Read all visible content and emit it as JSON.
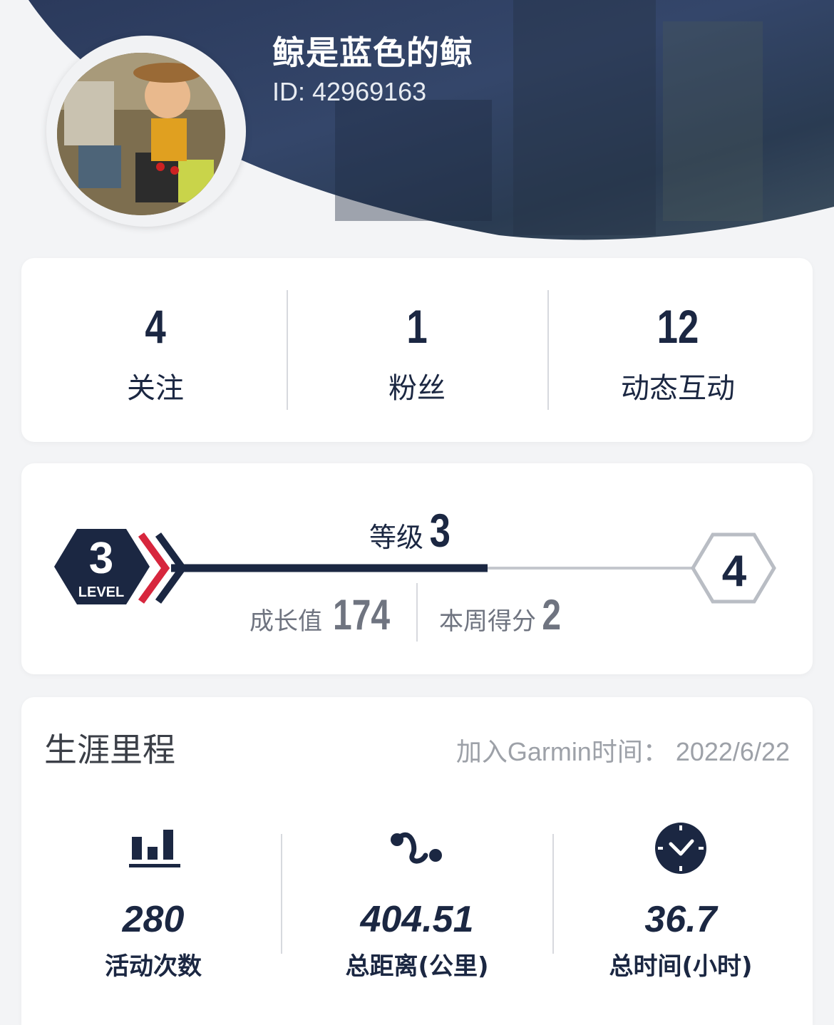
{
  "profile": {
    "username": "鲸是蓝色的鲸",
    "id_text": "ID: 42969163"
  },
  "social": [
    {
      "value": "4",
      "label": "关注"
    },
    {
      "value": "1",
      "label": "粉丝"
    },
    {
      "value": "12",
      "label": "动态互动"
    }
  ],
  "level": {
    "title": "等级",
    "current": "3",
    "badge_number": "3",
    "badge_text": "LEVEL",
    "next": "4",
    "progress": 0.6,
    "growth_label": "成长值",
    "growth_value": "174",
    "weekly_label": "本周得分",
    "weekly_value": "2"
  },
  "career": {
    "title": "生涯里程",
    "join_text": "加入Garmin时间： 2022/6/22",
    "metrics": [
      {
        "icon": "bar-chart-icon",
        "value": "280",
        "label": "活动次数"
      },
      {
        "icon": "route-icon",
        "value": "404.51",
        "label": "总距离(公里)"
      },
      {
        "icon": "clock-icon",
        "value": "36.7",
        "label": "总时间(小时)"
      }
    ]
  },
  "colors": {
    "navy": "#1b2742",
    "accent_red": "#d7263d",
    "page_bg": "#f3f4f6"
  }
}
